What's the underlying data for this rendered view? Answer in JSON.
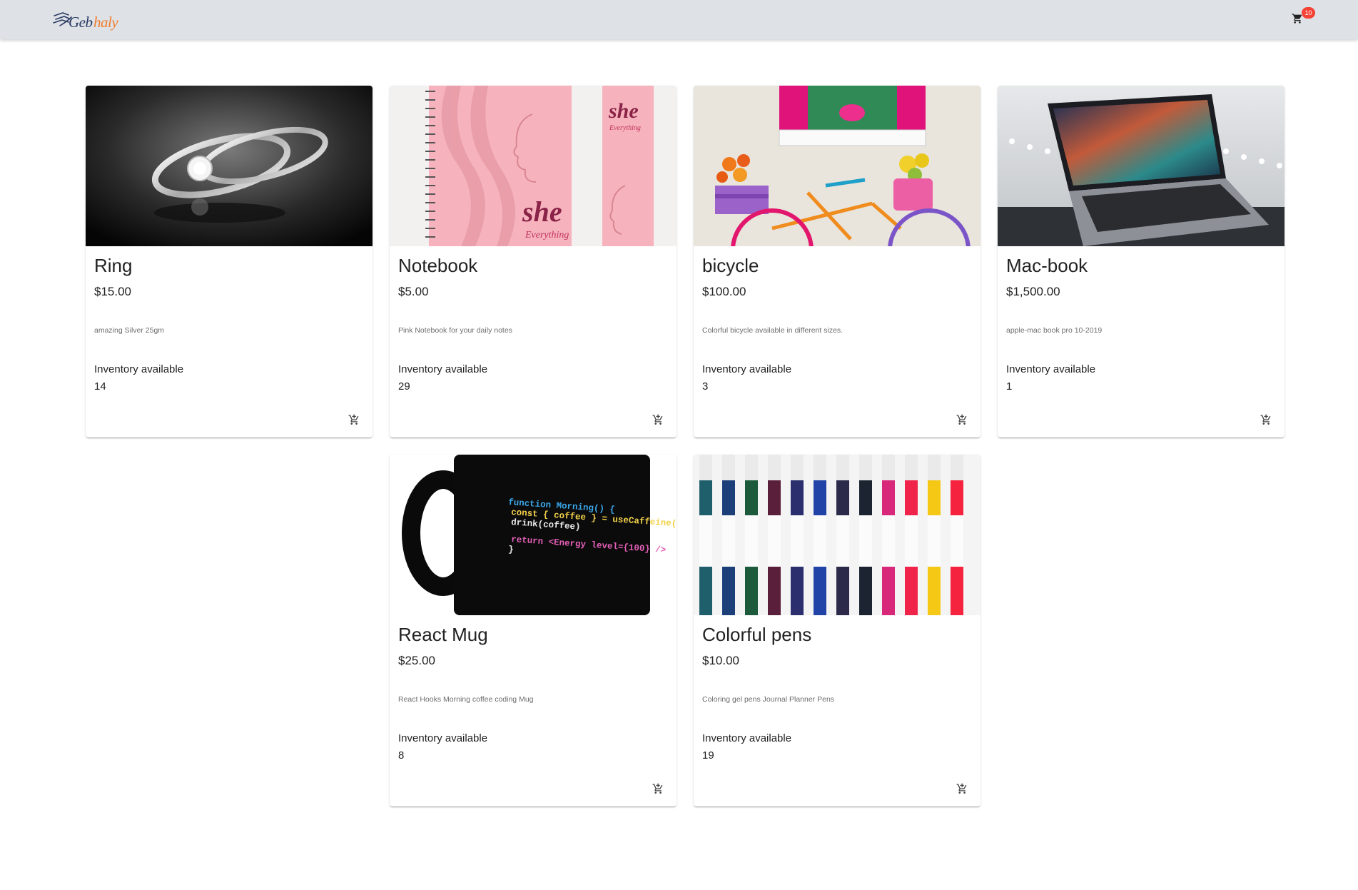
{
  "header": {
    "logo_text": "Gebhaly",
    "cart_count": "10"
  },
  "products": [
    {
      "title": "Ring",
      "price": "$15.00",
      "description": "amazing Silver 25gm",
      "inventory_label": "Inventory available",
      "inventory": "14"
    },
    {
      "title": "Notebook",
      "price": "$5.00",
      "description": "Pink Notebook for your daily notes",
      "inventory_label": "Inventory available",
      "inventory": "29"
    },
    {
      "title": "bicycle",
      "price": "$100.00",
      "description": "Colorful bicycle available in different sizes.",
      "inventory_label": "Inventory available",
      "inventory": "3"
    },
    {
      "title": "Mac-book",
      "price": "$1,500.00",
      "description": "apple-mac book pro 10-2019",
      "inventory_label": "Inventory available",
      "inventory": "1"
    },
    {
      "title": "React Mug",
      "price": "$25.00",
      "description": "React Hooks Morning coffee coding Mug",
      "inventory_label": "Inventory available",
      "inventory": "8"
    },
    {
      "title": "Colorful pens",
      "price": "$10.00",
      "description": "Coloring gel pens Journal Planner Pens",
      "inventory_label": "Inventory available",
      "inventory": "19"
    }
  ],
  "mug_code": {
    "line1": "function Morning() {",
    "line2": "const { coffee } = useCaffeine()",
    "line3": "drink(coffee)",
    "line4": "return <Energy level={100} />",
    "line5": "}"
  },
  "notebook_art": {
    "word1": "she",
    "word2": "Everything"
  },
  "icons": {
    "cart": "shopping-cart-icon",
    "add_to_cart": "add-shopping-cart-icon"
  },
  "colors": {
    "appbar": "#dee2e6",
    "badge": "#f44336",
    "logo_dark": "#2b3a63",
    "logo_accent": "#f07b2c"
  }
}
